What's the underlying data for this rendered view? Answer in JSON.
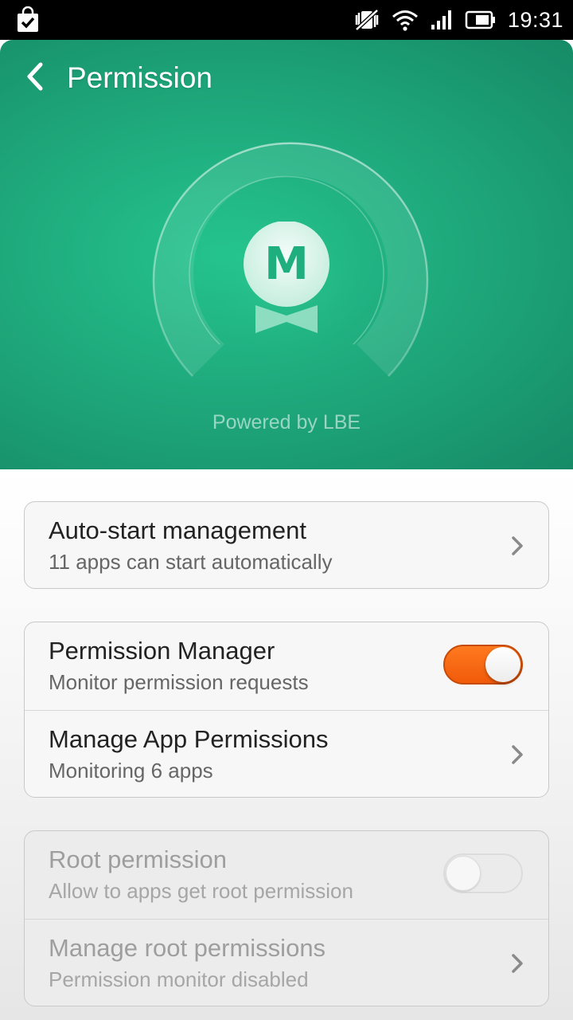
{
  "status_bar": {
    "time": "19:31",
    "icons": [
      "bag-check-icon",
      "vibrate-off-icon",
      "wifi-icon",
      "signal-icon",
      "battery-icon"
    ]
  },
  "header": {
    "title": "Permission",
    "back_icon": "chevron-left-icon",
    "logo_letter": "M",
    "powered_by": "Powered by LBE"
  },
  "colors": {
    "header_green": "#1faa7c",
    "toggle_on": "#f26510",
    "toggle_off": "#ebebeb"
  },
  "sections": [
    {
      "rows": [
        {
          "title": "Auto-start management",
          "subtitle": "11 apps can start automatically",
          "control": "chevron"
        }
      ]
    },
    {
      "rows": [
        {
          "title": "Permission Manager",
          "subtitle": "Monitor permission requests",
          "control": "toggle",
          "state": "on"
        },
        {
          "title": "Manage App Permissions",
          "subtitle": "Monitoring 6 apps",
          "control": "chevron"
        }
      ]
    },
    {
      "disabled": true,
      "rows": [
        {
          "title": "Root permission",
          "subtitle": "Allow to apps get root permission",
          "control": "toggle",
          "state": "off"
        },
        {
          "title": "Manage root permissions",
          "subtitle": "Permission monitor disabled",
          "control": "chevron"
        }
      ]
    }
  ]
}
